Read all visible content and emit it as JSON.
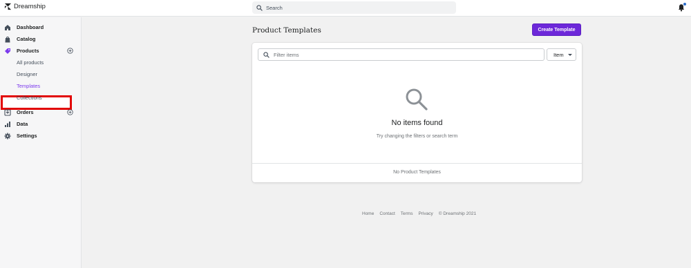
{
  "app": {
    "name": "Dreamship"
  },
  "search": {
    "placeholder": "Search"
  },
  "sidebar": {
    "items": [
      {
        "label": "Dashboard",
        "icon": "home-icon"
      },
      {
        "label": "Catalog",
        "icon": "catalog-bag-icon"
      },
      {
        "label": "Products",
        "icon": "tag-icon",
        "has_add": true
      },
      {
        "label": "Orders",
        "icon": "orders-inbox-icon",
        "has_add": true
      },
      {
        "label": "Data",
        "icon": "bar-chart-icon"
      },
      {
        "label": "Settings",
        "icon": "gear-icon"
      }
    ],
    "products_sub": [
      "All products",
      "Designer",
      "Templates",
      "Collections"
    ],
    "active_sub": "Templates"
  },
  "main": {
    "title": "Product Templates",
    "create_button": "Create Template",
    "filter_placeholder": "Filter items",
    "filter_type": "Item",
    "empty_title": "No items found",
    "empty_subtitle": "Try changing the filters or search term",
    "card_footer": "No Product Templates"
  },
  "footer": {
    "links": [
      "Home",
      "Contact",
      "Terms",
      "Privacy"
    ],
    "copyright": "© Dreamship 2021"
  },
  "colors": {
    "accent": "#6d28d9",
    "active_text": "#7c3aed",
    "highlight_border": "#e20000",
    "notification_dot": "#2c6ecb"
  }
}
